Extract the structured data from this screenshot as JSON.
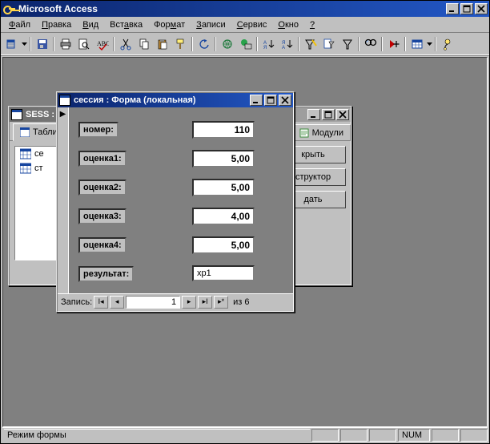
{
  "app": {
    "title": "Microsoft Access"
  },
  "menu": {
    "file": "Файл",
    "edit": "Правка",
    "view": "Вид",
    "insert": "Вставка",
    "format": "Формат",
    "records": "Записи",
    "tools": "Сервис",
    "window": "Окно",
    "help": "?"
  },
  "db_window": {
    "title": "SESS :",
    "tabs": {
      "tables": "Табли",
      "last": "Модули"
    },
    "objects": [
      "се",
      "ст"
    ],
    "buttons": {
      "open": "крыть",
      "design": "структор",
      "new": "дать"
    }
  },
  "form_window": {
    "title": "сессия : Форма (локальная)",
    "labels": {
      "nomer": "номер:",
      "oc1": "оценка1:",
      "oc2": "оценка2:",
      "oc3": "оценка3:",
      "oc4": "оценка4:",
      "result": "результат:"
    },
    "values": {
      "nomer": "110",
      "oc1": "5,00",
      "oc2": "5,00",
      "oc3": "4,00",
      "oc4": "5,00",
      "result": "хр1"
    },
    "recnav": {
      "label": "Запись:",
      "current": "1",
      "of": "из  6"
    }
  },
  "statusbar": {
    "mode": "Режим формы",
    "num": "NUM"
  }
}
